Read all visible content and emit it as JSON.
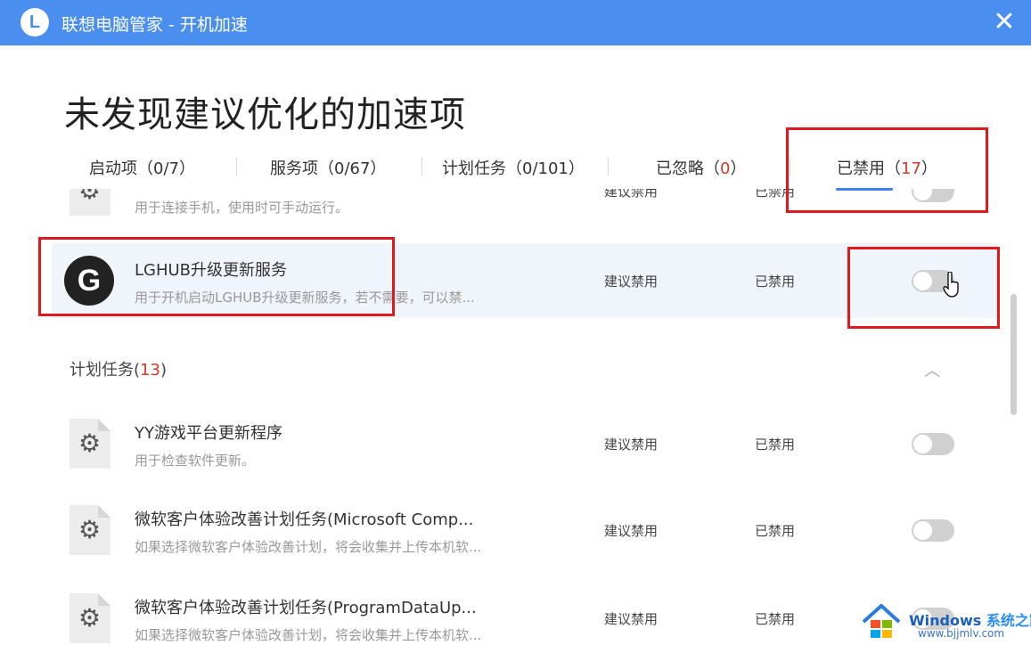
{
  "titlebar": {
    "logo_letter": "L",
    "title": "联想电脑管家 - 开机加速",
    "close_glyph": "✕"
  },
  "heading": "未发现建议优化的加速项",
  "tabs": [
    {
      "label": "启动项（",
      "num": "0/7",
      "suffix": "）"
    },
    {
      "label": "服务项（",
      "num": "0/67",
      "suffix": "）"
    },
    {
      "label": "计划任务（",
      "num": "0/101",
      "suffix": "）"
    },
    {
      "label": "已忽略（",
      "num": "0",
      "suffix": "）"
    },
    {
      "label": "已禁用（",
      "num": "17",
      "suffix": "）"
    }
  ],
  "services": [
    {
      "icon": "gear-icon",
      "name": "",
      "desc": "用于连接手机，使用时可手动运行。",
      "suggestion": "建议禁用",
      "status": "已禁用"
    },
    {
      "icon": "logitech-g-icon",
      "logo_letter": "G",
      "name": "LGHUB升级更新服务",
      "desc": "用于开机启动LGHUB升级更新服务，若不需要，可以禁...",
      "suggestion": "建议禁用",
      "status": "已禁用"
    }
  ],
  "section": {
    "label": "计划任务",
    "open": "(",
    "count": "13",
    "close": ")",
    "chevron": "︿"
  },
  "tasks": [
    {
      "icon": "gear-icon",
      "name": "YY游戏平台更新程序",
      "desc": "用于检查软件更新。",
      "suggestion": "建议禁用",
      "status": "已禁用"
    },
    {
      "icon": "gear-icon",
      "name": "微软客户体验改善计划任务(Microsoft Comp...",
      "desc": "如果选择微软客户体验改善计划，将会收集并上传本机软...",
      "suggestion": "建议禁用",
      "status": "已禁用"
    },
    {
      "icon": "gear-icon",
      "name": "微软客户体验改善计划任务(ProgramDataUp...",
      "desc": "如果选择微软客户体验改善计划，将会收集并上传本机软...",
      "suggestion": "建议禁用",
      "status": "已禁用"
    }
  ],
  "watermark": {
    "title1": "Windows ",
    "title2": "系统之家",
    "url": "www.bjjmlv.com"
  },
  "colors": {
    "titlebar": "#4a8ef0",
    "accent": "#3b82f6",
    "red": "#d43a2a",
    "highlight_box": "#e0191f"
  }
}
